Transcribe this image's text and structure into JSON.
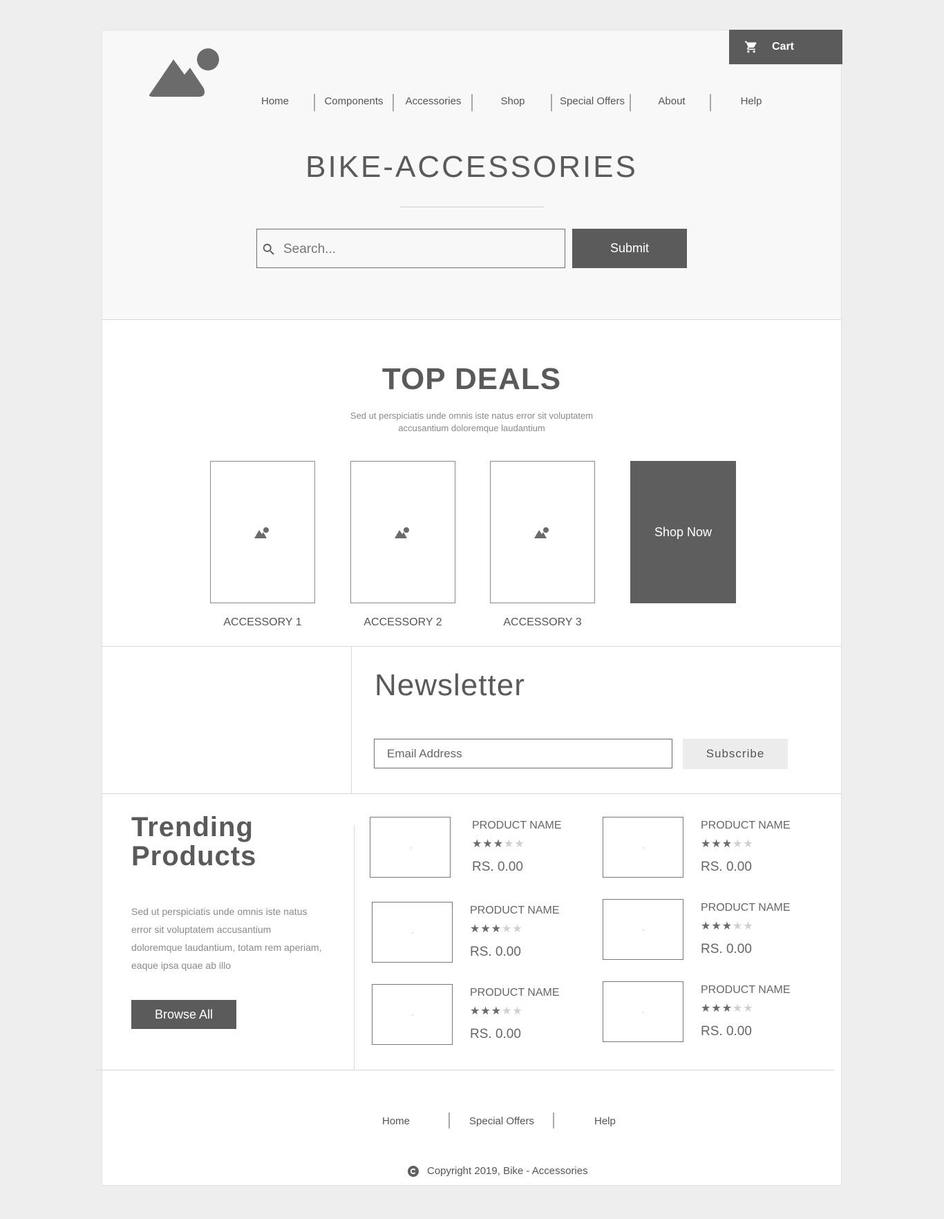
{
  "header": {
    "cart_label": "Cart",
    "nav": [
      "Home",
      "Components",
      "Accessories",
      "Shop",
      "Special Offers",
      "About",
      "Help"
    ],
    "site_title": "BIKE-ACCESSORIES",
    "search": {
      "placeholder": "Search..."
    },
    "submit_label": "Submit"
  },
  "top_deals": {
    "title": "TOP DEALS",
    "subtitle": "Sed ut perspiciatis unde omnis iste natus error sit voluptatem accusantium doloremque laudantium",
    "items": [
      "ACCESSORY 1",
      "ACCESSORY 2",
      "ACCESSORY 3"
    ],
    "shop_now_label": "Shop Now"
  },
  "newsletter": {
    "title": "Newsletter",
    "email_placeholder": "Email Address",
    "subscribe_label": "Subscribe"
  },
  "trending": {
    "title_line1": "Trending",
    "title_line2": "Products",
    "description": "Sed ut perspiciatis unde omnis iste natus error sit voluptatem accusantium doloremque laudantium, totam rem aperiam, eaque ipsa quae ab illo",
    "browse_label": "Browse All",
    "products": [
      {
        "name": "PRODUCT NAME",
        "rating": 3,
        "max_rating": 5,
        "price": "RS. 0.00"
      },
      {
        "name": "PRODUCT NAME",
        "rating": 3,
        "max_rating": 5,
        "price": "RS. 0.00"
      },
      {
        "name": "PRODUCT NAME",
        "rating": 3,
        "max_rating": 5,
        "price": "RS. 0.00"
      },
      {
        "name": "PRODUCT NAME",
        "rating": 3,
        "max_rating": 5,
        "price": "RS. 0.00"
      },
      {
        "name": "PRODUCT NAME",
        "rating": 3,
        "max_rating": 5,
        "price": "RS. 0.00"
      },
      {
        "name": "PRODUCT NAME",
        "rating": 3,
        "max_rating": 5,
        "price": "RS. 0.00"
      }
    ]
  },
  "footer": {
    "links": [
      "Home",
      "Special Offers",
      "Help"
    ],
    "copyright": "Copyright 2019, Bike - Accessories"
  },
  "icons": {
    "logo": "mountain-sun-icon",
    "cart": "shopping-cart-icon",
    "search": "search-icon",
    "image_placeholder": "image-placeholder-icon",
    "copyright": "copyright-icon"
  },
  "colors": {
    "background": "#eeeeee",
    "header_bg": "#f8f8f8",
    "dark_button": "#5b5b5b",
    "light_button": "#ececec",
    "text": "#5a5a5a"
  }
}
